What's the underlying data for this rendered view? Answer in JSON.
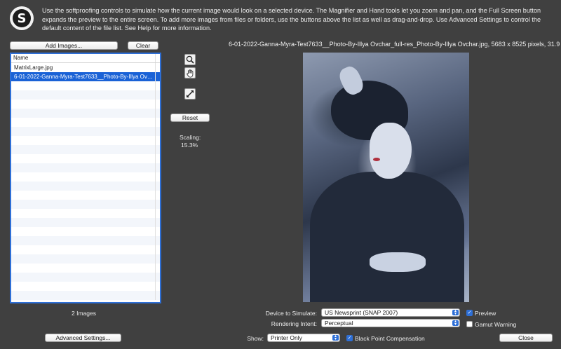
{
  "app": {
    "logo_letter": "S",
    "instructions": "Use the softproofing controls to simulate how the current image would look on a selected device. The Magnifier and Hand tools let you zoom and pan, and the Full Screen button expands the preview to the entire screen. To add more images from files or folders, use the buttons above the list as well as drag-and-drop. Use Advanced Settings to control the default content of the file list. See Help for more information."
  },
  "file_panel": {
    "add_images_label": "Add Images...",
    "clear_label": "Clear",
    "column_header": "Name",
    "files": [
      {
        "name": "MatrixLarge.jpg",
        "selected": false
      },
      {
        "name": "6-01-2022-Ganna-Myra-Test7633__Photo-By-Illya Ovchar_full-res_Photo-By-Illya Ovchar.jpg",
        "selected": true
      }
    ],
    "count_label": "2 Images",
    "advanced_settings_label": "Advanced Settings..."
  },
  "tools": {
    "magnifier": "magnifier-icon",
    "hand": "hand-icon",
    "fullscreen": "fullscreen-icon",
    "reset_label": "Reset",
    "scaling_label": "Scaling:",
    "scaling_value": "15.3%"
  },
  "preview": {
    "image_title": "6-01-2022-Ganna-Myra-Test7633__Photo-By-Illya Ovchar_full-res_Photo-By-Illya Ovchar.jpg, 5683 x 8525 pixels, 31.9 MB"
  },
  "settings": {
    "device_label": "Device to Simulate:",
    "device_value": "US Newsprint (SNAP 2007)",
    "intent_label": "Rendering Intent:",
    "intent_value": "Perceptual",
    "preview_label": "Preview",
    "preview_checked": true,
    "gamut_label": "Gamut Warning",
    "gamut_checked": false,
    "show_label": "Show:",
    "show_value": "Printer Only",
    "bpc_label": "Black Point Compensation",
    "bpc_checked": true,
    "close_label": "Close"
  },
  "colors": {
    "background": "#404040",
    "accent": "#2e6fd6",
    "selection": "#1a62d6"
  }
}
